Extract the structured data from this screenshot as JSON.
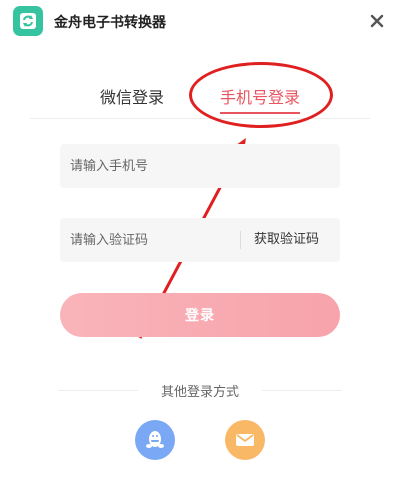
{
  "app": {
    "title": "金舟电子书转换器",
    "logo_icon": "refresh-book-icon",
    "brand_color": "#36c4a0"
  },
  "tabs": [
    {
      "label": "微信登录",
      "active": false
    },
    {
      "label": "手机号登录",
      "active": true
    }
  ],
  "form": {
    "phone_placeholder": "请输入手机号",
    "phone_value": "",
    "code_placeholder": "请输入验证码",
    "code_value": "",
    "get_code_label": "获取验证码",
    "login_label": "登录"
  },
  "other": {
    "label": "其他登录方式",
    "methods": [
      {
        "icon": "qq-penguin-icon",
        "color": "#7aa8f5"
      },
      {
        "icon": "mail-icon",
        "color": "#f9b866"
      }
    ]
  },
  "colors": {
    "accent": "#e8555f",
    "annotation": "#e02020",
    "button": "#f8a3ab"
  }
}
